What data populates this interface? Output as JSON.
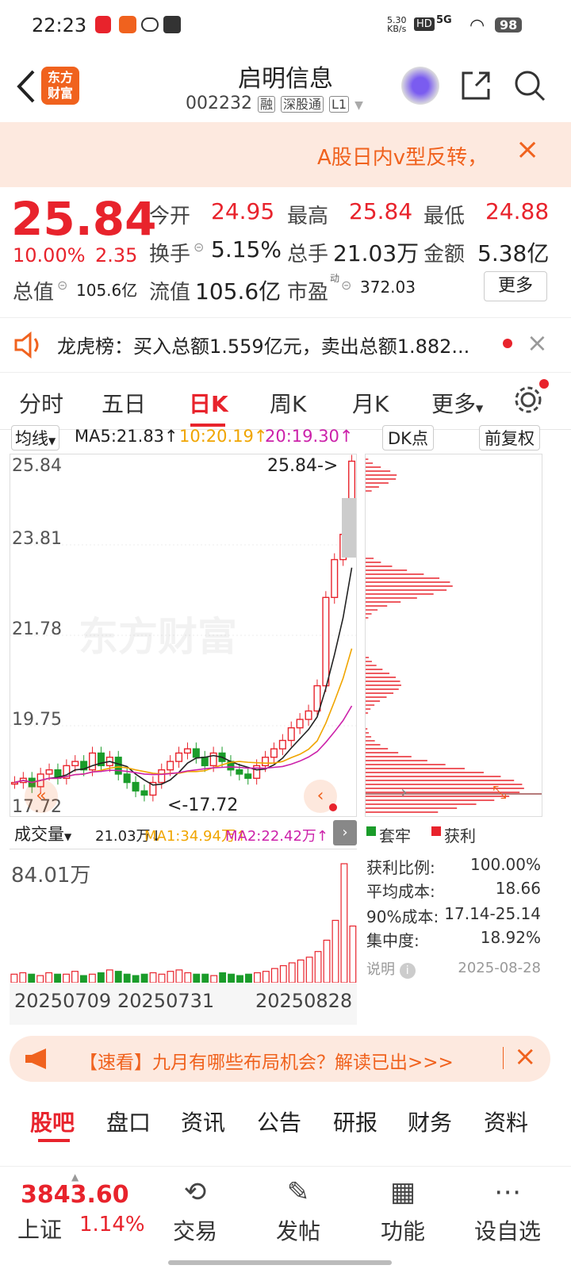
{
  "status": {
    "time": "22:23",
    "net_speed_top": "5.30",
    "net_speed_unit": "KB/s",
    "hd": "HD",
    "signal": "5G",
    "battery": "98"
  },
  "header": {
    "back_icon": "chevron-left-icon",
    "app_badge_line1": "东方",
    "app_badge_line2": "财富",
    "title": "启明信息",
    "code": "002232",
    "tag1": "融",
    "tag2": "深股通",
    "tag3": "L1"
  },
  "banner": {
    "text": "A股日内v型反转，",
    "close": "×"
  },
  "quote": {
    "price": "25.84",
    "change_pct": "10.00%",
    "change": "2.35",
    "open_label": "今开",
    "open": "24.95",
    "high_label": "最高",
    "high": "25.84",
    "low_label": "最低",
    "low": "24.88",
    "turnover_label": "换手",
    "turnover": "5.15%",
    "volume_label": "总手",
    "volume": "21.03万",
    "amount_label": "金额",
    "amount": "5.38亿",
    "total_mv_label": "总值",
    "total_mv": "105.6亿",
    "float_mv_label": "流值",
    "float_mv": "105.6亿",
    "pe_label": "市盈",
    "pe_sup": "动",
    "pe": "372.03",
    "more": "更多"
  },
  "lhb": {
    "text": "龙虎榜：买入总额1.559亿元，卖出总额1.882..."
  },
  "tabs": [
    "分时",
    "五日",
    "日K",
    "周K",
    "月K",
    "更多"
  ],
  "ma_legend": {
    "selector": "均线",
    "ma5": "MA5:21.83↑",
    "ma10": "10:20.19↑",
    "ma20": "20:19.30↑",
    "dk": "DK点",
    "adjust": "前复权"
  },
  "kline": {
    "y_labels": [
      "25.84",
      "23.81",
      "21.78",
      "19.75",
      "17.72"
    ],
    "high_marker": "25.84->",
    "low_marker": "<-17.72",
    "watermark": "东方财富"
  },
  "vol_legend": {
    "selector": "成交量",
    "vol": "21.03万↓",
    "ma1": "MA1:34.94万↑",
    "ma2": "MA2:22.42万↑"
  },
  "volume": {
    "max_label": "84.01万",
    "dates": [
      "20250709",
      "20250731",
      "20250828"
    ]
  },
  "chip": {
    "legend_trapped": "套牢",
    "legend_profit": "获利",
    "profit_ratio_label": "获利比例:",
    "profit_ratio": "100.00%",
    "avg_cost_label": "平均成本:",
    "avg_cost": "18.66",
    "cost90_label": "90%成本:",
    "cost90": "17.14-25.14",
    "concentration_label": "集中度:",
    "concentration": "18.92%",
    "note_label": "说明",
    "date": "2025-08-28"
  },
  "promo": {
    "text": "【速看】九月有哪些布局机会？解读已出>>>"
  },
  "subtabs": [
    "股吧",
    "盘口",
    "资讯",
    "公告",
    "研报",
    "财务",
    "资料"
  ],
  "bottom": {
    "index_value": "3843.60",
    "index_name": "上证",
    "index_change": "1.14%",
    "nav": [
      "交易",
      "发帖",
      "功能",
      "设自选"
    ]
  },
  "colors": {
    "up": "#e8232c",
    "down": "#1a9c2a",
    "ma5": "#222222",
    "ma10": "#f0a500",
    "ma20": "#cc22aa",
    "accent": "#f0621e"
  }
}
